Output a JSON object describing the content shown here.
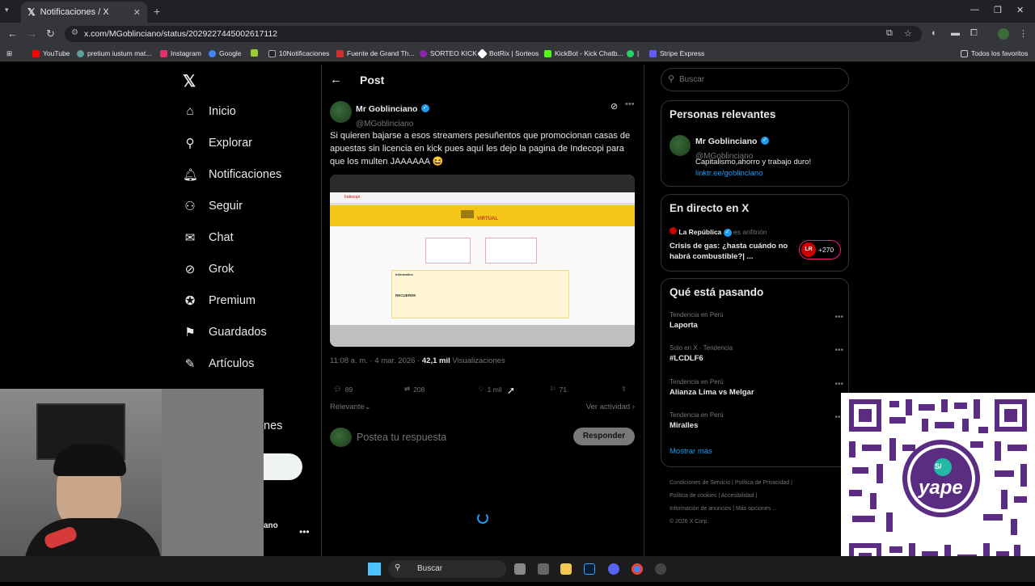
{
  "browser": {
    "tab_title": "Notificaciones / X",
    "url": "x.com/MGoblinciano/status/2029227445002617112",
    "bookmarks": [
      {
        "label": "YouTube",
        "color": "#ff0000"
      },
      {
        "label": "pretium iustum mat...",
        "color": "#5f9ea0"
      },
      {
        "label": "Instagram",
        "color": "#e1306c"
      },
      {
        "label": "Google",
        "color": "#4285f4"
      },
      {
        "label": "",
        "color": "#c0c0c0"
      },
      {
        "label": "10Notificaciones",
        "color": "#1f1f1f"
      },
      {
        "label": "Fuente de Grand Th...",
        "color": "#d32f2f"
      },
      {
        "label": "SORTEO KICK",
        "color": "#8e24aa"
      },
      {
        "label": "BotRix | Sorteos",
        "color": "#ffffff"
      },
      {
        "label": "KickBot - Kick Chatb...",
        "color": "#53fc18"
      },
      {
        "label": "|",
        "color": "#25d366"
      },
      {
        "label": "Stripe Express",
        "color": "#635bff"
      }
    ],
    "all_favorites": "Todos los favoritos"
  },
  "sidebar": {
    "items": [
      {
        "label": "Inicio",
        "icon": "home-icon"
      },
      {
        "label": "Explorar",
        "icon": "search-icon"
      },
      {
        "label": "Notificaciones",
        "icon": "bell-icon"
      },
      {
        "label": "Seguir",
        "icon": "follow-icon"
      },
      {
        "label": "Chat",
        "icon": "mail-icon"
      },
      {
        "label": "Grok",
        "icon": "grok-icon"
      },
      {
        "label": "Premium",
        "icon": "premium-icon"
      },
      {
        "label": "Guardados",
        "icon": "bookmark-icon"
      },
      {
        "label": "Artículos",
        "icon": "article-icon"
      }
    ],
    "cut_label": "nes",
    "account_cut": "ano"
  },
  "post": {
    "header": "Post",
    "author_name": "Mr Goblinciano",
    "author_handle": "@MGoblinciano",
    "text": "Si quieren bajarse a esos streamers pesuñentos que promocionan casas de apuestas sin licencia en kick pues aquí les dejo la pagina de Indecopi para que los multen JAAAAAA 😆",
    "time": "11:08 a. m. · 4 mar. 2026 ·",
    "views": "42,1 mil",
    "views_label": "Visualizaciones",
    "replies": "89",
    "reposts": "208",
    "likes": "1 mil",
    "bookmarks": "71",
    "sort": "Relevante",
    "activity": "Ver actividad",
    "reply_placeholder": "Postea tu respuesta",
    "reply_button": "Responder",
    "media": {
      "site_name": "Indecopi",
      "banner_title": "VIRTUAL",
      "section_label": "Informativo",
      "recuerde": "RECUERDE"
    }
  },
  "right": {
    "search_placeholder": "Buscar",
    "relevant_title": "Personas relevantes",
    "relevant_name": "Mr Goblinciano",
    "relevant_handle": "@MGoblinciano",
    "relevant_bio": "Capitalismo,ahorro y trabajo duro!",
    "relevant_link": "linktr.ee/goblinciano",
    "live_title": "En directo en X",
    "live_source": "La República",
    "live_host": "es anfitrión",
    "live_text": "Crisis de gas: ¿hasta cuándo no habrá combustible?| ...",
    "live_badge": "LR",
    "live_count": "+270",
    "trends_title": "Qué está pasando",
    "trends": [
      {
        "category": "Tendencia en Perú",
        "title": "Laporta"
      },
      {
        "category": "Solo en X · Tendencia",
        "title": "#LCDLF6"
      },
      {
        "category": "Tendencia en Perú",
        "title": "Alianza Lima vs Melgar"
      },
      {
        "category": "Tendencia en Perú",
        "title": "Miralles"
      }
    ],
    "show_more": "Mostrar más",
    "footer": [
      "Condiciones de Servicio",
      "Política de Privacidad",
      "Política de cookies",
      "Accesibilidad",
      "Información de anuncios",
      "Más opciones ...",
      "© 2026 X Corp."
    ]
  },
  "taskbar": {
    "search": "Buscar"
  },
  "qr": {
    "brand": "yape",
    "currency": "S/"
  }
}
